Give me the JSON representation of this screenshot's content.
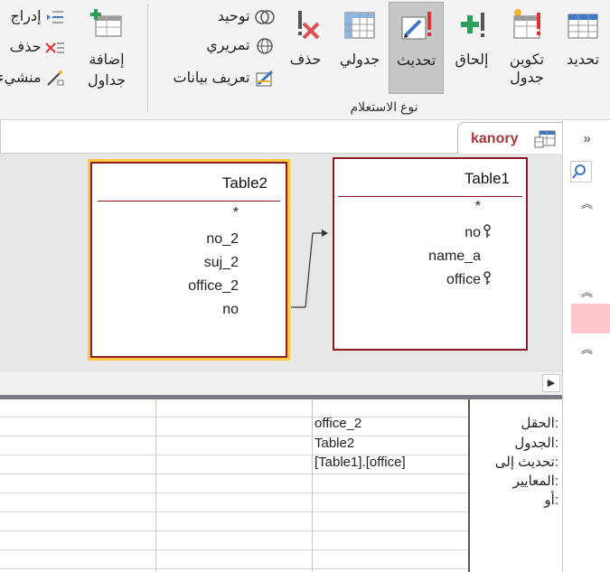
{
  "ribbon": {
    "buttons": {
      "select": "تحديد",
      "make_table_line1": "تكوين",
      "make_table_line2": "جدول",
      "append": "إلحاق",
      "update": "تحديث",
      "crosstab": "جدولي",
      "delete": "حذف"
    },
    "small_items": {
      "union": "توحيد",
      "pass_through": "تمريري",
      "data_definition": "تعريف بيانات"
    },
    "group_label": "نوع الاستعلام",
    "show_table_line1": "إضافة",
    "show_table_line2": "جداول",
    "left_items": {
      "insert": "إدراج",
      "delete": "حذف",
      "builder": "منشيء"
    }
  },
  "tab": {
    "title": "kanory"
  },
  "tables": [
    {
      "name": "Table2",
      "star": "*",
      "fields": [
        "no_2",
        "suj_2",
        "office_2",
        "no"
      ]
    },
    {
      "name": "Table1",
      "star": "*",
      "fields": [
        "no",
        "name_a",
        "office"
      ]
    }
  ],
  "grid": {
    "row_labels": [
      "الحقل:",
      "الجدول:",
      "تحديث إلى:",
      "المعايير:",
      "أو:"
    ],
    "columns": [
      {
        "field": "office_2",
        "table": "Table2",
        "update_to": "[Table1].[office]",
        "criteria": "",
        "or": ""
      },
      {
        "field": "",
        "table": "",
        "update_to": "",
        "criteria": "",
        "or": ""
      },
      {
        "field": "",
        "table": "",
        "update_to": "",
        "criteria": "",
        "or": ""
      }
    ]
  },
  "colors": {
    "accent": "#a4373a",
    "table_border": "#8b1c26",
    "selected_table_outline": "#ffc83d",
    "active_button": "#c6c6c6"
  },
  "icons": {
    "select": "select-query-icon",
    "make_table": "make-table-icon",
    "append": "append-query-icon",
    "update": "update-query-icon",
    "crosstab": "crosstab-icon",
    "delete": "delete-query-icon",
    "union": "union-icon",
    "pass_through": "globe-icon",
    "data_definition": "data-definition-icon",
    "show_table": "show-table-icon",
    "tab": "query-tab-icon",
    "search": "search-icon"
  }
}
